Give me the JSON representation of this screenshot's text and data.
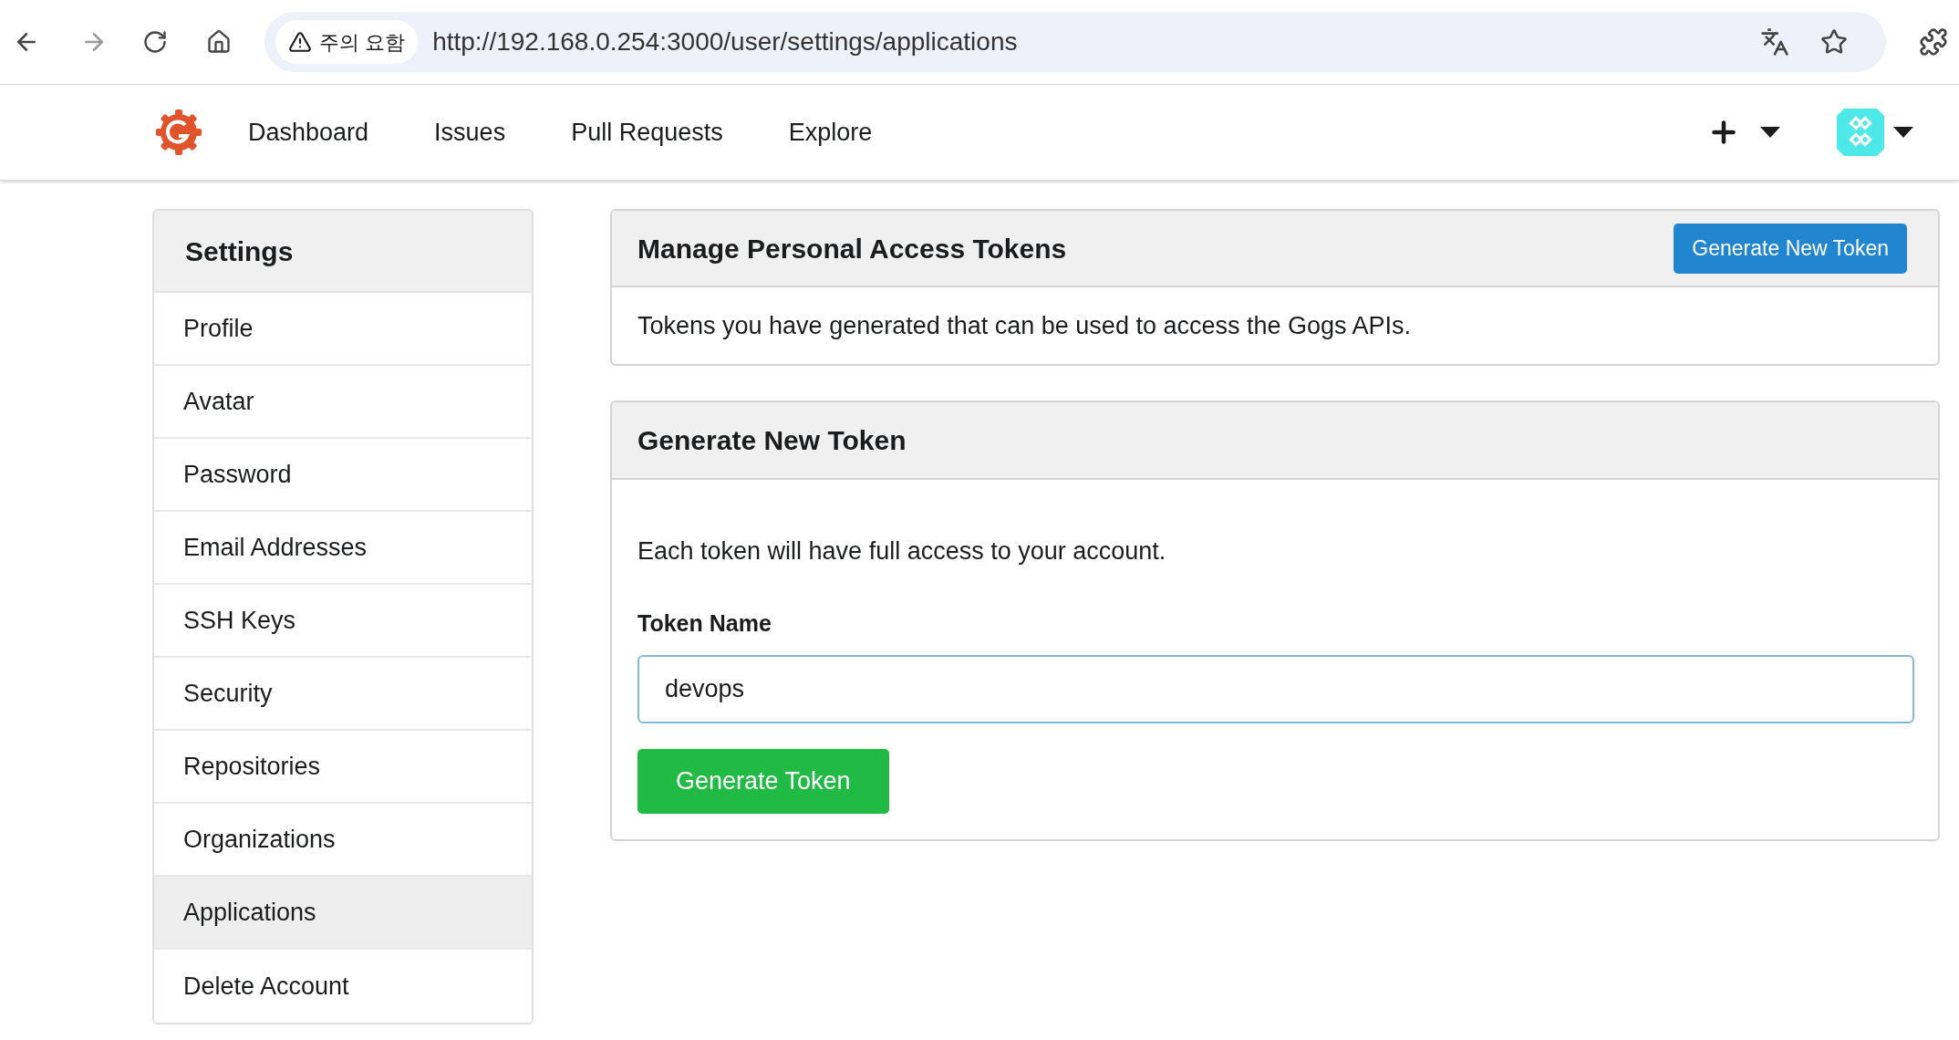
{
  "browser": {
    "security_badge": "주의 요함",
    "url": "http://192.168.0.254:3000/user/settings/applications"
  },
  "nav": {
    "items": [
      "Dashboard",
      "Issues",
      "Pull Requests",
      "Explore"
    ]
  },
  "sidebar": {
    "title": "Settings",
    "items": [
      {
        "label": "Profile",
        "selected": false
      },
      {
        "label": "Avatar",
        "selected": false
      },
      {
        "label": "Password",
        "selected": false
      },
      {
        "label": "Email Addresses",
        "selected": false
      },
      {
        "label": "SSH Keys",
        "selected": false
      },
      {
        "label": "Security",
        "selected": false
      },
      {
        "label": "Repositories",
        "selected": false
      },
      {
        "label": "Organizations",
        "selected": false
      },
      {
        "label": "Applications",
        "selected": true
      },
      {
        "label": "Delete Account",
        "selected": false
      }
    ]
  },
  "tokens_panel": {
    "title": "Manage Personal Access Tokens",
    "button": "Generate New Token",
    "description": "Tokens you have generated that can be used to access the Gogs APIs."
  },
  "generate_panel": {
    "title": "Generate New Token",
    "description": "Each token will have full access to your account.",
    "field_label": "Token Name",
    "field_value": "devops",
    "submit": "Generate Token"
  }
}
